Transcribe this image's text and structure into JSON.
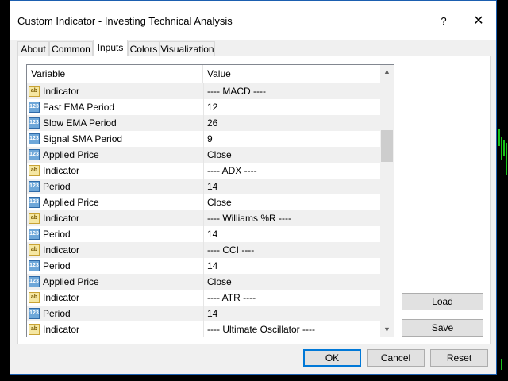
{
  "window": {
    "title": "Custom Indicator - Investing Technical Analysis",
    "help_label": "?",
    "close_label": "✕"
  },
  "tabs": [
    {
      "label": "About",
      "active": false
    },
    {
      "label": "Common",
      "active": false
    },
    {
      "label": "Inputs",
      "active": true
    },
    {
      "label": "Colors",
      "active": false
    },
    {
      "label": "Visualization",
      "active": false
    }
  ],
  "grid": {
    "headers": {
      "variable": "Variable",
      "value": "Value"
    },
    "rows": [
      {
        "type": "string",
        "variable": "Indicator",
        "value": "---- MACD ----"
      },
      {
        "type": "number",
        "variable": "Fast EMA Period",
        "value": "12"
      },
      {
        "type": "number",
        "variable": "Slow EMA Period",
        "value": "26"
      },
      {
        "type": "number",
        "variable": "Signal SMA Period",
        "value": "9"
      },
      {
        "type": "number",
        "variable": "Applied Price",
        "value": "Close"
      },
      {
        "type": "string",
        "variable": "Indicator",
        "value": "---- ADX ----"
      },
      {
        "type": "number",
        "variable": "Period",
        "value": "14"
      },
      {
        "type": "number",
        "variable": "Applied Price",
        "value": "Close"
      },
      {
        "type": "string",
        "variable": "Indicator",
        "value": "---- Williams %R ----"
      },
      {
        "type": "number",
        "variable": "Period",
        "value": "14"
      },
      {
        "type": "string",
        "variable": "Indicator",
        "value": "---- CCI ----"
      },
      {
        "type": "number",
        "variable": "Period",
        "value": "14"
      },
      {
        "type": "number",
        "variable": "Applied Price",
        "value": "Close"
      },
      {
        "type": "string",
        "variable": "Indicator",
        "value": "---- ATR ----"
      },
      {
        "type": "number",
        "variable": "Period",
        "value": "14"
      },
      {
        "type": "string",
        "variable": "Indicator",
        "value": "---- Ultimate Oscillator ----"
      }
    ],
    "icon_labels": {
      "string": "ab",
      "number": "123"
    }
  },
  "side_buttons": {
    "load": "Load",
    "save": "Save"
  },
  "footer_buttons": {
    "ok": "OK",
    "cancel": "Cancel",
    "reset": "Reset"
  },
  "colors": {
    "accent": "#0078d7",
    "chart_green": "#19c019",
    "title_border": "#1b5fb0"
  }
}
